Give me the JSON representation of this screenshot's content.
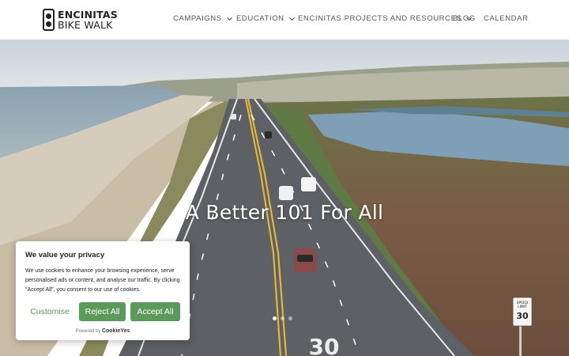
{
  "header": {
    "logo_line1": "ENCINITAS",
    "logo_line2": "BIKE WALK",
    "nav": [
      {
        "label": "CAMPAIGNS",
        "dropdown": true
      },
      {
        "label": "EDUCATION",
        "dropdown": true
      },
      {
        "label": "ENCINITAS PROJECTS AND RESOURCES",
        "dropdown": true
      },
      {
        "label": "BLOG",
        "dropdown": false
      },
      {
        "label": "CALENDAR",
        "dropdown": false
      }
    ]
  },
  "hero": {
    "title": "A Better 101 For All",
    "slides_count": 3,
    "active_slide": 1,
    "road_marking": "30",
    "speed_sign": {
      "line1": "SPEED",
      "line2": "LIMIT",
      "value": "30"
    }
  },
  "cookie_banner": {
    "title": "We value your privacy",
    "body": "We use cookies to enhance your browsing experience, serve personalised ads or content, and analyse our traffic. By clicking \"Accept All\", you consent to our use of cookies.",
    "customise_label": "Customise",
    "reject_label": "Reject All",
    "accept_label": "Accept All",
    "powered_by": "Powered by",
    "brand": "CookieYes",
    "accent_color": "#5c9a5b"
  }
}
